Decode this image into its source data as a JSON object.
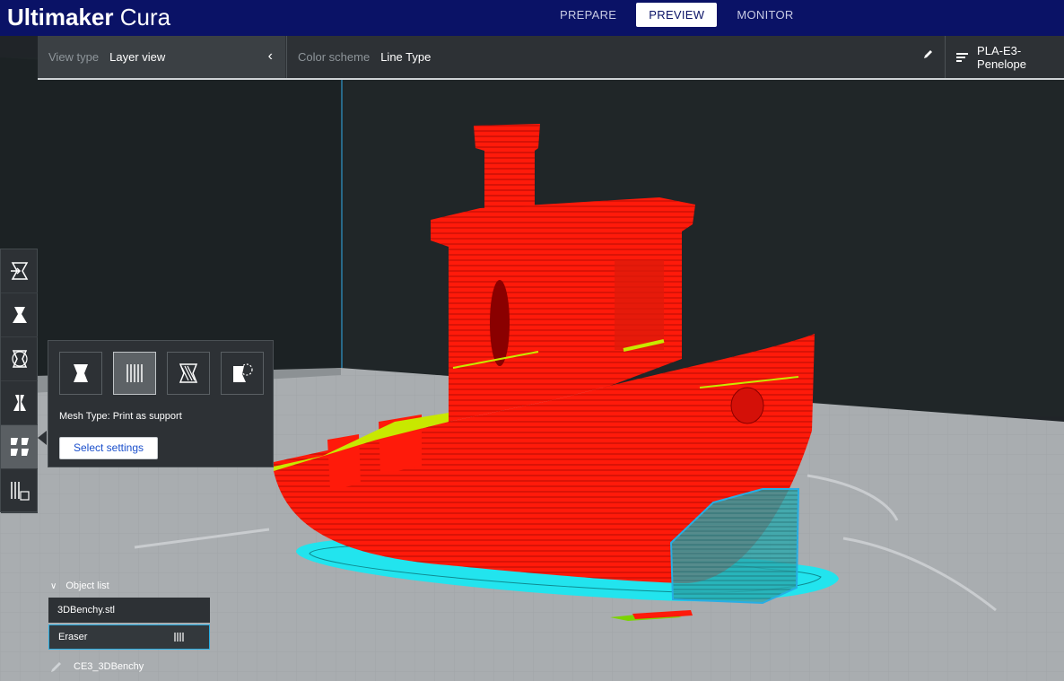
{
  "app": {
    "brand_bold": "Ultimaker",
    "brand_light": "Cura"
  },
  "stages": [
    {
      "label": "PREPARE",
      "active": false
    },
    {
      "label": "PREVIEW",
      "active": true
    },
    {
      "label": "MONITOR",
      "active": false
    }
  ],
  "view_panel": {
    "view_type_label": "View type",
    "view_type_value": "Layer view",
    "color_scheme_label": "Color scheme",
    "color_scheme_value": "Line Type",
    "material_profile": "PLA-E3-Penelope"
  },
  "toolbar": {
    "tools": [
      "move-tool",
      "scale-tool",
      "rotate-tool",
      "mirror-tool",
      "per-model-settings-tool",
      "support-blocker-tool"
    ],
    "active_tool": "per-model-settings-tool"
  },
  "per_model_popup": {
    "mesh_types": [
      "normal-model",
      "print-as-support",
      "modify-overlaps",
      "support-blocker"
    ],
    "selected_mesh": "print-as-support",
    "mesh_type_text": "Mesh Type: Print as support",
    "select_settings_label": "Select settings"
  },
  "object_list": {
    "header": "Object list",
    "items": [
      "3DBenchy.stl",
      "Eraser"
    ],
    "selected": "Eraser"
  },
  "job_name": "CE3_3DBenchy",
  "colors": {
    "header_bg": "#0a1266",
    "model_red": "#ff1a0a",
    "skirt_cyan": "#22e4ee",
    "infill_yellow": "#c8e800",
    "accent_blue": "#27aee4"
  }
}
